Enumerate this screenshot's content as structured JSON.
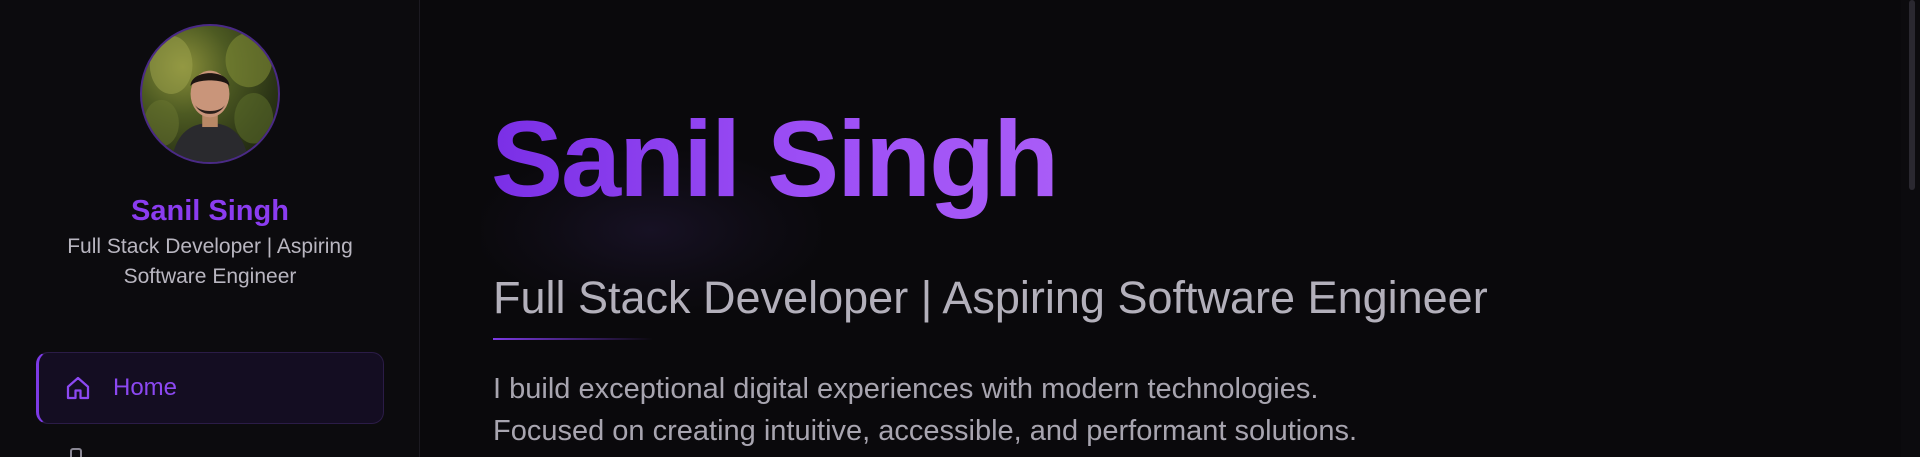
{
  "sidebar": {
    "profile": {
      "name": "Sanil Singh",
      "title": "Full Stack Developer | Aspiring Software Engineer",
      "avatar_icon": "profile-photo"
    },
    "nav": [
      {
        "label": "Home",
        "icon": "home-icon",
        "active": true
      },
      {
        "label": "",
        "icon": "user-icon",
        "active": false
      }
    ]
  },
  "hero": {
    "name": "Sanil Singh",
    "subtitle": "Full Stack Developer | Aspiring Software Engineer",
    "bio_line1": "I build exceptional digital experiences with modern technologies.",
    "bio_line2": "Focused on creating intuitive, accessible, and performant solutions."
  },
  "colors": {
    "background": "#0a090c",
    "accent": "#8b3cf0",
    "text_muted": "#b3b0bb"
  }
}
